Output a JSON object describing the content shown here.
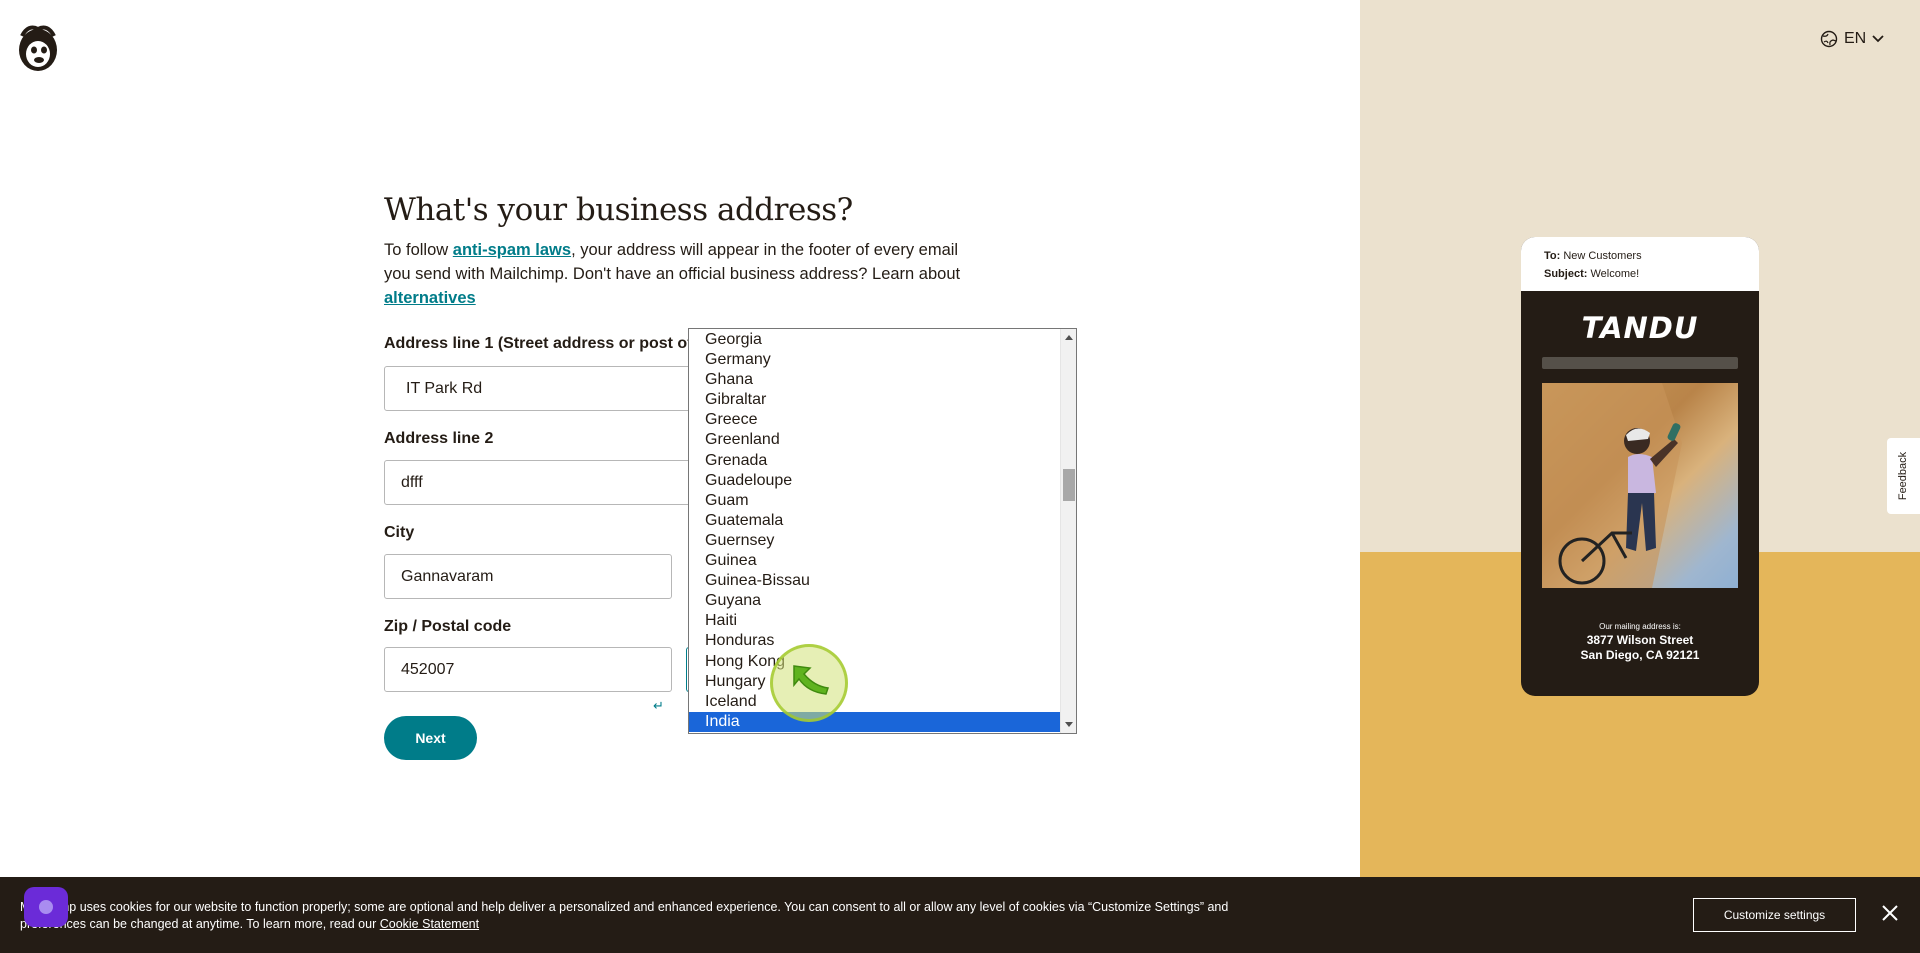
{
  "header": {
    "language": "EN"
  },
  "form": {
    "title": "What's your business address?",
    "intro_part1": "To follow ",
    "intro_link1": "anti-spam laws",
    "intro_part2": ", your address will appear in the footer of every email you send with Mailchimp. Don't have an official business address? Learn about ",
    "intro_link2": "alternatives",
    "address1_label": "Address line 1 (Street address or post off",
    "address1_value": "IT Park Rd",
    "address2_label": "Address line 2",
    "address2_value": "dfff",
    "city_label": "City",
    "city_value": "Gannavaram",
    "zip_label": "Zip / Postal code",
    "zip_value": "452007",
    "enter_hint": "↵",
    "next_label": "Next"
  },
  "country_dropdown": {
    "options": [
      "Georgia",
      "Germany",
      "Ghana",
      "Gibraltar",
      "Greece",
      "Greenland",
      "Grenada",
      "Guadeloupe",
      "Guam",
      "Guatemala",
      "Guernsey",
      "Guinea",
      "Guinea-Bissau",
      "Guyana",
      "Haiti",
      "Honduras",
      "Hong Kong",
      "Hungary",
      "Iceland",
      "India"
    ],
    "selected": "India"
  },
  "preview": {
    "to_label": "To:",
    "to_value": "New Customers",
    "subject_label": "Subject:",
    "subject_value": "Welcome!",
    "brand": "TANDU",
    "mailing_label": "Our mailing address is:",
    "address_line1": "3877 Wilson Street",
    "address_line2": "San Diego, CA 92121"
  },
  "feedback_label": "Feedback",
  "cookie": {
    "text_line1": "Mailchimp uses cookies for our website to function properly; some are optional and help deliver a personalized and enhanced experience. You can consent to all or allow any level of cookies via “Customize Settings” and",
    "text_line2": "preferences can be changed at anytime. To learn more, read our ",
    "link": "Cookie Statement",
    "button": "Customize settings"
  },
  "colors": {
    "accent": "#007c89",
    "selected": "#1a66d9",
    "dark": "#241c15",
    "beige": "#ebe1ce",
    "mustard": "#e4b65a"
  }
}
